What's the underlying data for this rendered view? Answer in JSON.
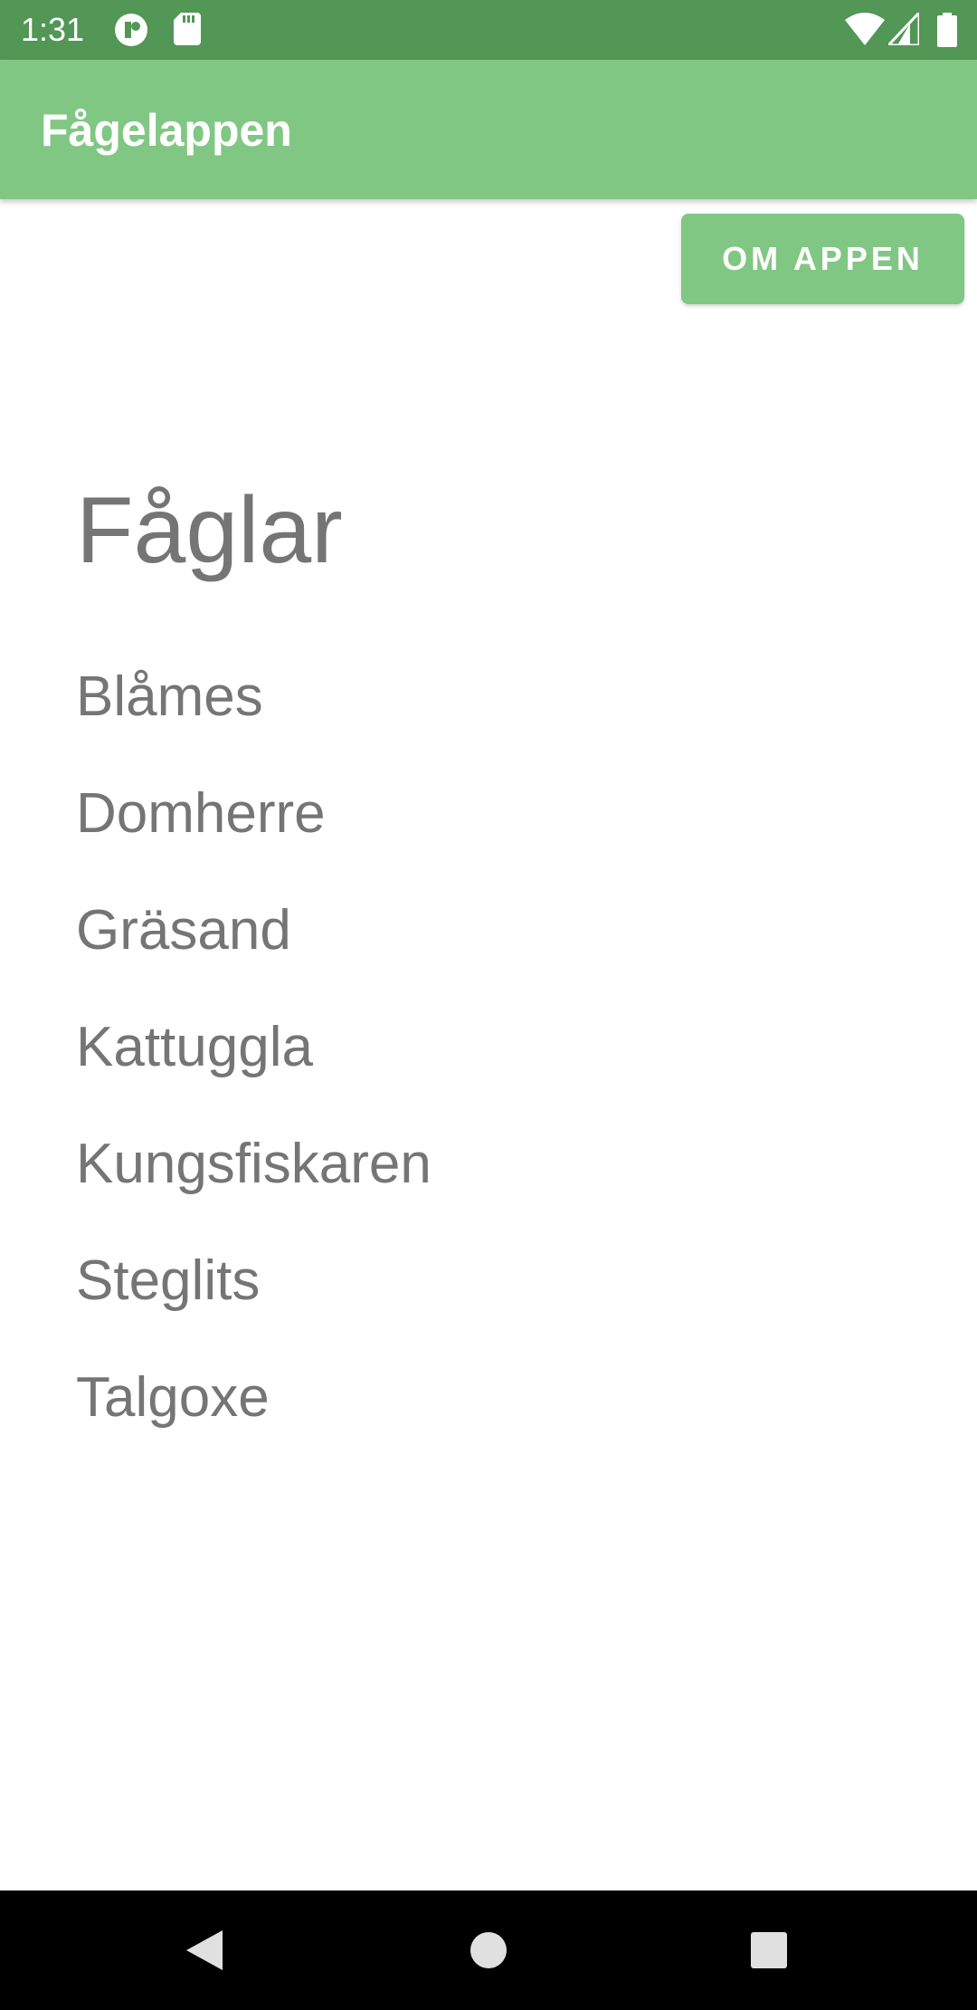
{
  "status_bar": {
    "time": "1:31",
    "background": "#529755",
    "icons": [
      "notification-app-icon",
      "sd-card-icon",
      "wifi-icon",
      "cellular-signal-icon",
      "battery-icon"
    ]
  },
  "app_bar": {
    "title": "Fågelappen",
    "background": "#81c784"
  },
  "about_button": {
    "label": "OM APPEN"
  },
  "main": {
    "heading": "Fåglar",
    "birds": [
      "Blåmes",
      "Domherre",
      "Gräsand",
      "Kattuggla",
      "Kungsfiskaren",
      "Steglits",
      "Talgoxe"
    ]
  },
  "nav_bar": {
    "buttons": [
      "back-icon",
      "home-icon",
      "recents-icon"
    ]
  }
}
